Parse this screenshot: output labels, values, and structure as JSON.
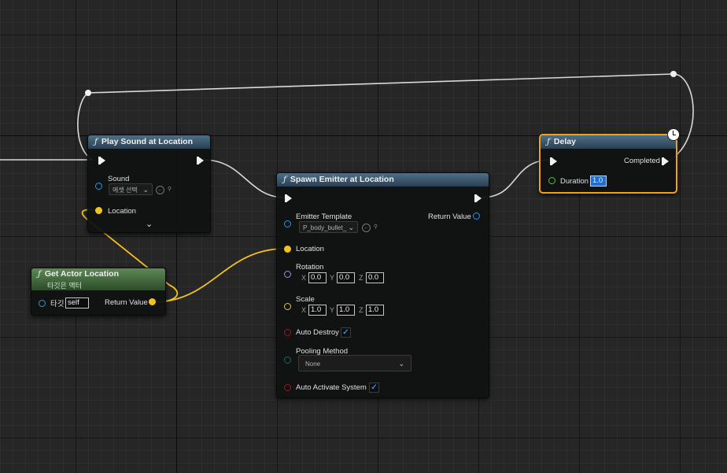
{
  "nodes": {
    "play_sound": {
      "title": "Play Sound at Location",
      "sound_label": "Sound",
      "sound_asset": "에셋 선택",
      "location_label": "Location",
      "expand_icon": "chevron-down"
    },
    "get_actor_location": {
      "title": "Get Actor Location",
      "subtitle": "타깃은 액터",
      "target_label": "타깃",
      "target_value": "self",
      "return_label": "Return Value"
    },
    "spawn_emitter": {
      "title": "Spawn Emitter at Location",
      "emitter_template_label": "Emitter Template",
      "emitter_template_value": "P_body_bullet_",
      "return_label": "Return Value",
      "location_label": "Location",
      "rotation_label": "Rotation",
      "rotation": {
        "x_label": "X",
        "x": "0.0",
        "y_label": "Y",
        "y": "0.0",
        "z_label": "Z",
        "z": "0.0"
      },
      "scale_label": "Scale",
      "scale": {
        "x_label": "X",
        "x": "1.0",
        "y_label": "Y",
        "y": "1.0",
        "z_label": "Z",
        "z": "1.0"
      },
      "auto_destroy_label": "Auto Destroy",
      "auto_destroy": true,
      "pooling_method_label": "Pooling Method",
      "pooling_method_value": "None",
      "auto_activate_label": "Auto Activate System",
      "auto_activate": true
    },
    "delay": {
      "title": "Delay",
      "completed_label": "Completed",
      "duration_label": "Duration",
      "duration_value": "1.0"
    }
  },
  "colors": {
    "exec_wire": "#d9d9d9",
    "vector_pin": "#f5c21d",
    "object_pin": "#1e9ce8",
    "bool_pin": "#a0141c",
    "float_pin": "#3ccf3c",
    "rotator_pin": "#8e9bd8",
    "enum_pin": "#0f6b68",
    "selection": "#f0a020"
  },
  "glyphs": {
    "function_icon": "ƒ",
    "check": "✓",
    "chevron": "⌄"
  }
}
